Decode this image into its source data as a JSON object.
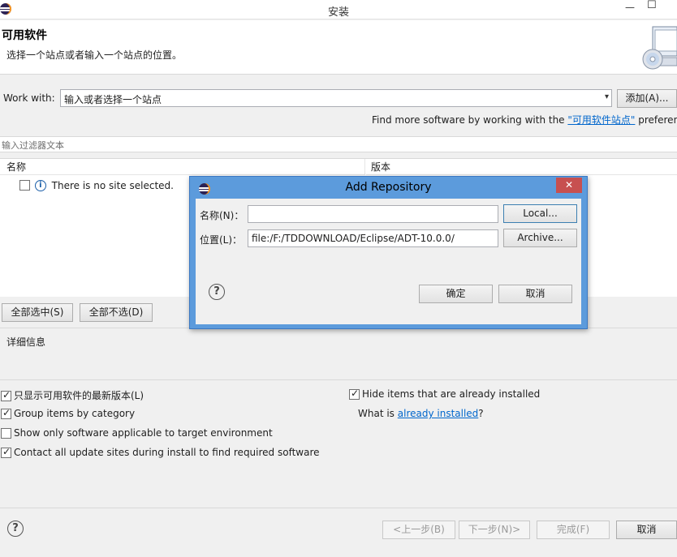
{
  "window": {
    "title": "安装",
    "minimize_glyph": "—",
    "maximize_glyph": "☐",
    "icon": "eclipse-icon"
  },
  "banner": {
    "title": "可用软件",
    "description": "选择一个站点或者输入一个站点的位置。",
    "graphic": "software-install-icon"
  },
  "work_with": {
    "label": "Work with:",
    "value": "输入或者选择一个站点",
    "add_button": "添加(A)...",
    "find_more_prefix": "Find more software by working with the ",
    "find_more_link": "\"可用软件站点\"",
    "find_more_suffix": " preferenc"
  },
  "filter": {
    "placeholder": "输入过滤器文本"
  },
  "table": {
    "columns": [
      "名称",
      "版本"
    ],
    "rows": [
      {
        "checked": false,
        "icon": "info-icon",
        "text": "There is no site selected."
      }
    ]
  },
  "selection_buttons": {
    "select_all": "全部选中(S)",
    "deselect_all": "全部不选(D)"
  },
  "details": {
    "label": "详细信息"
  },
  "options": {
    "left": [
      {
        "label": "只显示可用软件的最新版本(L)",
        "checked": true
      },
      {
        "label": "Group items by category",
        "checked": true
      },
      {
        "label": "Show only software applicable to target environment",
        "checked": false
      },
      {
        "label": "Contact all update sites during install to find required software",
        "checked": true
      }
    ],
    "hide_installed": {
      "label": "Hide items that are already installed",
      "checked": true
    },
    "what_is_prefix": "What is ",
    "what_is_link": "already installed",
    "what_is_suffix": "?"
  },
  "footer": {
    "back": "<上一步(B)",
    "next": "下一步(N)>",
    "finish": "完成(F)",
    "cancel": "取消"
  },
  "dialog": {
    "title": "Add Repository",
    "close_glyph": "✕",
    "name_label": "名称(N)：",
    "name_value": "",
    "location_label": "位置(L)：",
    "location_value": "file:/F:/TDDOWNLOAD/Eclipse/ADT-10.0.0/",
    "local_button": "Local...",
    "archive_button": "Archive...",
    "ok_button": "确定",
    "cancel_button": "取消"
  }
}
